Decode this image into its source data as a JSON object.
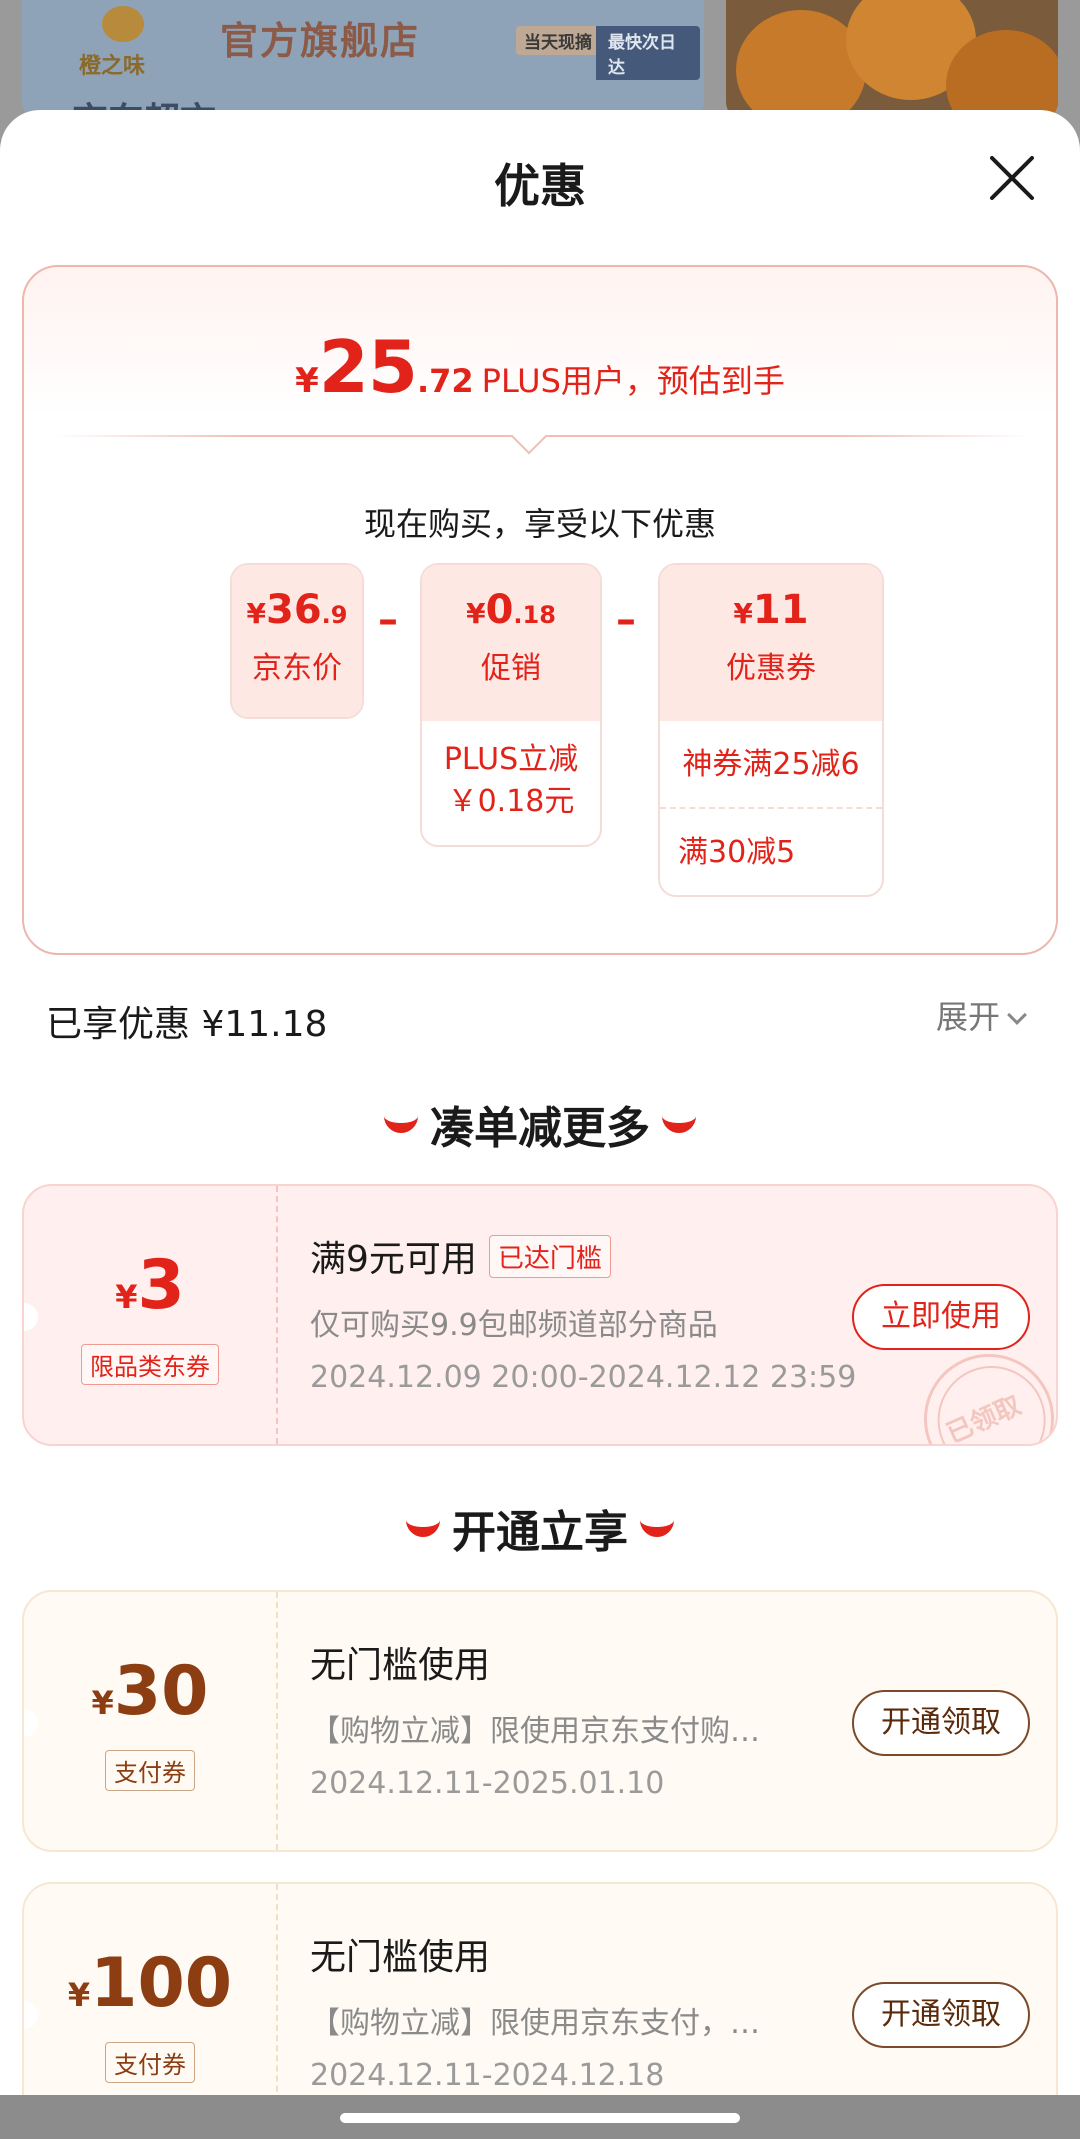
{
  "background": {
    "store_logo_text": "橙之味",
    "store_name": "官方旗舰店",
    "tag_pick": "当天现摘",
    "tag_delivery": "最快次日达",
    "store_sub": "京东超市"
  },
  "sheet": {
    "title": "优惠"
  },
  "estimate": {
    "currency": "¥",
    "integer": "25",
    "decimal": ".72",
    "label": "PLUS用户，预估到手"
  },
  "breakdown": {
    "intro": "现在购买，享受以下优惠",
    "minus": "–",
    "jd_price": {
      "currency": "¥",
      "integer": "36",
      "decimal": ".9",
      "caption": "京东价"
    },
    "promotion": {
      "currency": "¥",
      "integer": "0",
      "decimal": ".18",
      "caption": "促销",
      "details": [
        "PLUS立减",
        "￥0.18元"
      ]
    },
    "coupon": {
      "currency": "¥",
      "integer": "11",
      "decimal": "",
      "caption": "优惠券",
      "details": [
        "神券满25减6",
        "满30减5"
      ]
    }
  },
  "enjoyed": {
    "label": "已享优惠 ¥11.18",
    "expand": "展开"
  },
  "sections": {
    "more": "凑单减更多",
    "plus": "开通立享"
  },
  "coupons": [
    {
      "currency": "¥",
      "amount": "3",
      "kind": "限品类东券",
      "title": "满9元可用",
      "tag": "已达门槛",
      "desc": "仅可购买9.9包邮频道部分商品",
      "date": "2024.12.09 20:00-2024.12.12 23:59",
      "button": "立即使用",
      "stamp": "已领取"
    },
    {
      "currency": "¥",
      "amount": "30",
      "kind": "支付券",
      "title": "无门槛使用",
      "desc": "【购物立减】限使用京东支付购…",
      "date": "2024.12.11-2025.01.10",
      "button": "开通领取"
    },
    {
      "currency": "¥",
      "amount": "100",
      "kind": "支付券",
      "title": "无门槛使用",
      "desc": "【购物立减】限使用京东支付，…",
      "date": "2024.12.11-2024.12.18",
      "button": "开通领取"
    }
  ],
  "colors": {
    "accent_red": "#e2231a",
    "gold_brown": "#8c3d12",
    "card_border": "#ecb7ad"
  }
}
